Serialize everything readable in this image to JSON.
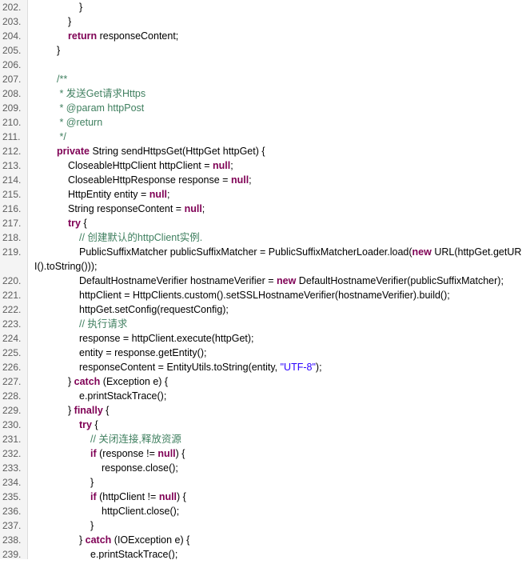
{
  "code": {
    "lines": [
      {
        "num": "202.",
        "indent": 3,
        "parts": [
          {
            "t": "}",
            "c": ""
          }
        ]
      },
      {
        "num": "203.",
        "indent": 2,
        "parts": [
          {
            "t": "}",
            "c": ""
          }
        ]
      },
      {
        "num": "204.",
        "indent": 2,
        "parts": [
          {
            "t": "return",
            "c": "kw"
          },
          {
            "t": " responseContent;",
            "c": ""
          }
        ]
      },
      {
        "num": "205.",
        "indent": 1,
        "parts": [
          {
            "t": "}",
            "c": ""
          }
        ]
      },
      {
        "num": "206.",
        "indent": 0,
        "parts": []
      },
      {
        "num": "207.",
        "indent": 1,
        "parts": [
          {
            "t": "/**",
            "c": "cm"
          }
        ]
      },
      {
        "num": "208.",
        "indent": 1,
        "parts": [
          {
            "t": " * 发送Get请求Https",
            "c": "cm"
          }
        ]
      },
      {
        "num": "209.",
        "indent": 1,
        "parts": [
          {
            "t": " * @param httpPost",
            "c": "cm"
          }
        ]
      },
      {
        "num": "210.",
        "indent": 1,
        "parts": [
          {
            "t": " * @return",
            "c": "cm"
          }
        ]
      },
      {
        "num": "211.",
        "indent": 1,
        "parts": [
          {
            "t": " */",
            "c": "cm"
          }
        ]
      },
      {
        "num": "212.",
        "indent": 1,
        "parts": [
          {
            "t": "private",
            "c": "kw"
          },
          {
            "t": " String sendHttpsGet(HttpGet httpGet) {",
            "c": ""
          }
        ]
      },
      {
        "num": "213.",
        "indent": 2,
        "parts": [
          {
            "t": "CloseableHttpClient httpClient = ",
            "c": ""
          },
          {
            "t": "null",
            "c": "kw"
          },
          {
            "t": ";",
            "c": ""
          }
        ]
      },
      {
        "num": "214.",
        "indent": 2,
        "parts": [
          {
            "t": "CloseableHttpResponse response = ",
            "c": ""
          },
          {
            "t": "null",
            "c": "kw"
          },
          {
            "t": ";",
            "c": ""
          }
        ]
      },
      {
        "num": "215.",
        "indent": 2,
        "parts": [
          {
            "t": "HttpEntity entity = ",
            "c": ""
          },
          {
            "t": "null",
            "c": "kw"
          },
          {
            "t": ";",
            "c": ""
          }
        ]
      },
      {
        "num": "216.",
        "indent": 2,
        "parts": [
          {
            "t": "String responseContent = ",
            "c": ""
          },
          {
            "t": "null",
            "c": "kw"
          },
          {
            "t": ";",
            "c": ""
          }
        ]
      },
      {
        "num": "217.",
        "indent": 2,
        "parts": [
          {
            "t": "try",
            "c": "kw"
          },
          {
            "t": " {",
            "c": ""
          }
        ]
      },
      {
        "num": "218.",
        "indent": 3,
        "parts": [
          {
            "t": "// 创建默认的httpClient实例.",
            "c": "cm"
          }
        ]
      },
      {
        "num": "219.",
        "indent": 3,
        "parts": [
          {
            "t": "PublicSuffixMatcher publicSuffixMatcher = PublicSuffixMatcherLoader.load(",
            "c": ""
          },
          {
            "t": "new",
            "c": "kw"
          },
          {
            "t": " URL(httpGet.getUR",
            "c": ""
          }
        ]
      },
      {
        "num": "",
        "indent": 0,
        "parts": [
          {
            "t": "I().toString()));",
            "c": ""
          }
        ]
      },
      {
        "num": "220.",
        "indent": 3,
        "parts": [
          {
            "t": "DefaultHostnameVerifier hostnameVerifier = ",
            "c": ""
          },
          {
            "t": "new",
            "c": "kw"
          },
          {
            "t": " DefaultHostnameVerifier(publicSuffixMatcher);",
            "c": ""
          }
        ]
      },
      {
        "num": "221.",
        "indent": 3,
        "parts": [
          {
            "t": "httpClient = HttpClients.custom().setSSLHostnameVerifier(hostnameVerifier).build();",
            "c": ""
          }
        ]
      },
      {
        "num": "222.",
        "indent": 3,
        "parts": [
          {
            "t": "httpGet.setConfig(requestConfig);",
            "c": ""
          }
        ]
      },
      {
        "num": "223.",
        "indent": 3,
        "parts": [
          {
            "t": "// 执行请求",
            "c": "cm"
          }
        ]
      },
      {
        "num": "224.",
        "indent": 3,
        "parts": [
          {
            "t": "response = httpClient.execute(httpGet);",
            "c": ""
          }
        ]
      },
      {
        "num": "225.",
        "indent": 3,
        "parts": [
          {
            "t": "entity = response.getEntity();",
            "c": ""
          }
        ]
      },
      {
        "num": "226.",
        "indent": 3,
        "parts": [
          {
            "t": "responseContent = EntityUtils.toString(entity, ",
            "c": ""
          },
          {
            "t": "\"UTF-8\"",
            "c": "st"
          },
          {
            "t": ");",
            "c": ""
          }
        ]
      },
      {
        "num": "227.",
        "indent": 2,
        "parts": [
          {
            "t": "} ",
            "c": ""
          },
          {
            "t": "catch",
            "c": "kw"
          },
          {
            "t": " (Exception e) {",
            "c": ""
          }
        ]
      },
      {
        "num": "228.",
        "indent": 3,
        "parts": [
          {
            "t": "e.printStackTrace();",
            "c": ""
          }
        ]
      },
      {
        "num": "229.",
        "indent": 2,
        "parts": [
          {
            "t": "} ",
            "c": ""
          },
          {
            "t": "finally",
            "c": "kw"
          },
          {
            "t": " {",
            "c": ""
          }
        ]
      },
      {
        "num": "230.",
        "indent": 3,
        "parts": [
          {
            "t": "try",
            "c": "kw"
          },
          {
            "t": " {",
            "c": ""
          }
        ]
      },
      {
        "num": "231.",
        "indent": 4,
        "parts": [
          {
            "t": "// 关闭连接,释放资源",
            "c": "cm"
          }
        ]
      },
      {
        "num": "232.",
        "indent": 4,
        "parts": [
          {
            "t": "if",
            "c": "kw"
          },
          {
            "t": " (response != ",
            "c": ""
          },
          {
            "t": "null",
            "c": "kw"
          },
          {
            "t": ") {",
            "c": ""
          }
        ]
      },
      {
        "num": "233.",
        "indent": 5,
        "parts": [
          {
            "t": "response.close();",
            "c": ""
          }
        ]
      },
      {
        "num": "234.",
        "indent": 4,
        "parts": [
          {
            "t": "}",
            "c": ""
          }
        ]
      },
      {
        "num": "235.",
        "indent": 4,
        "parts": [
          {
            "t": "if",
            "c": "kw"
          },
          {
            "t": " (httpClient != ",
            "c": ""
          },
          {
            "t": "null",
            "c": "kw"
          },
          {
            "t": ") {",
            "c": ""
          }
        ]
      },
      {
        "num": "236.",
        "indent": 5,
        "parts": [
          {
            "t": "httpClient.close();",
            "c": ""
          }
        ]
      },
      {
        "num": "237.",
        "indent": 4,
        "parts": [
          {
            "t": "}",
            "c": ""
          }
        ]
      },
      {
        "num": "238.",
        "indent": 3,
        "parts": [
          {
            "t": "} ",
            "c": ""
          },
          {
            "t": "catch",
            "c": "kw"
          },
          {
            "t": " (IOException e) {",
            "c": ""
          }
        ]
      },
      {
        "num": "239.",
        "indent": 4,
        "parts": [
          {
            "t": "e.printStackTrace();",
            "c": ""
          }
        ]
      }
    ]
  }
}
